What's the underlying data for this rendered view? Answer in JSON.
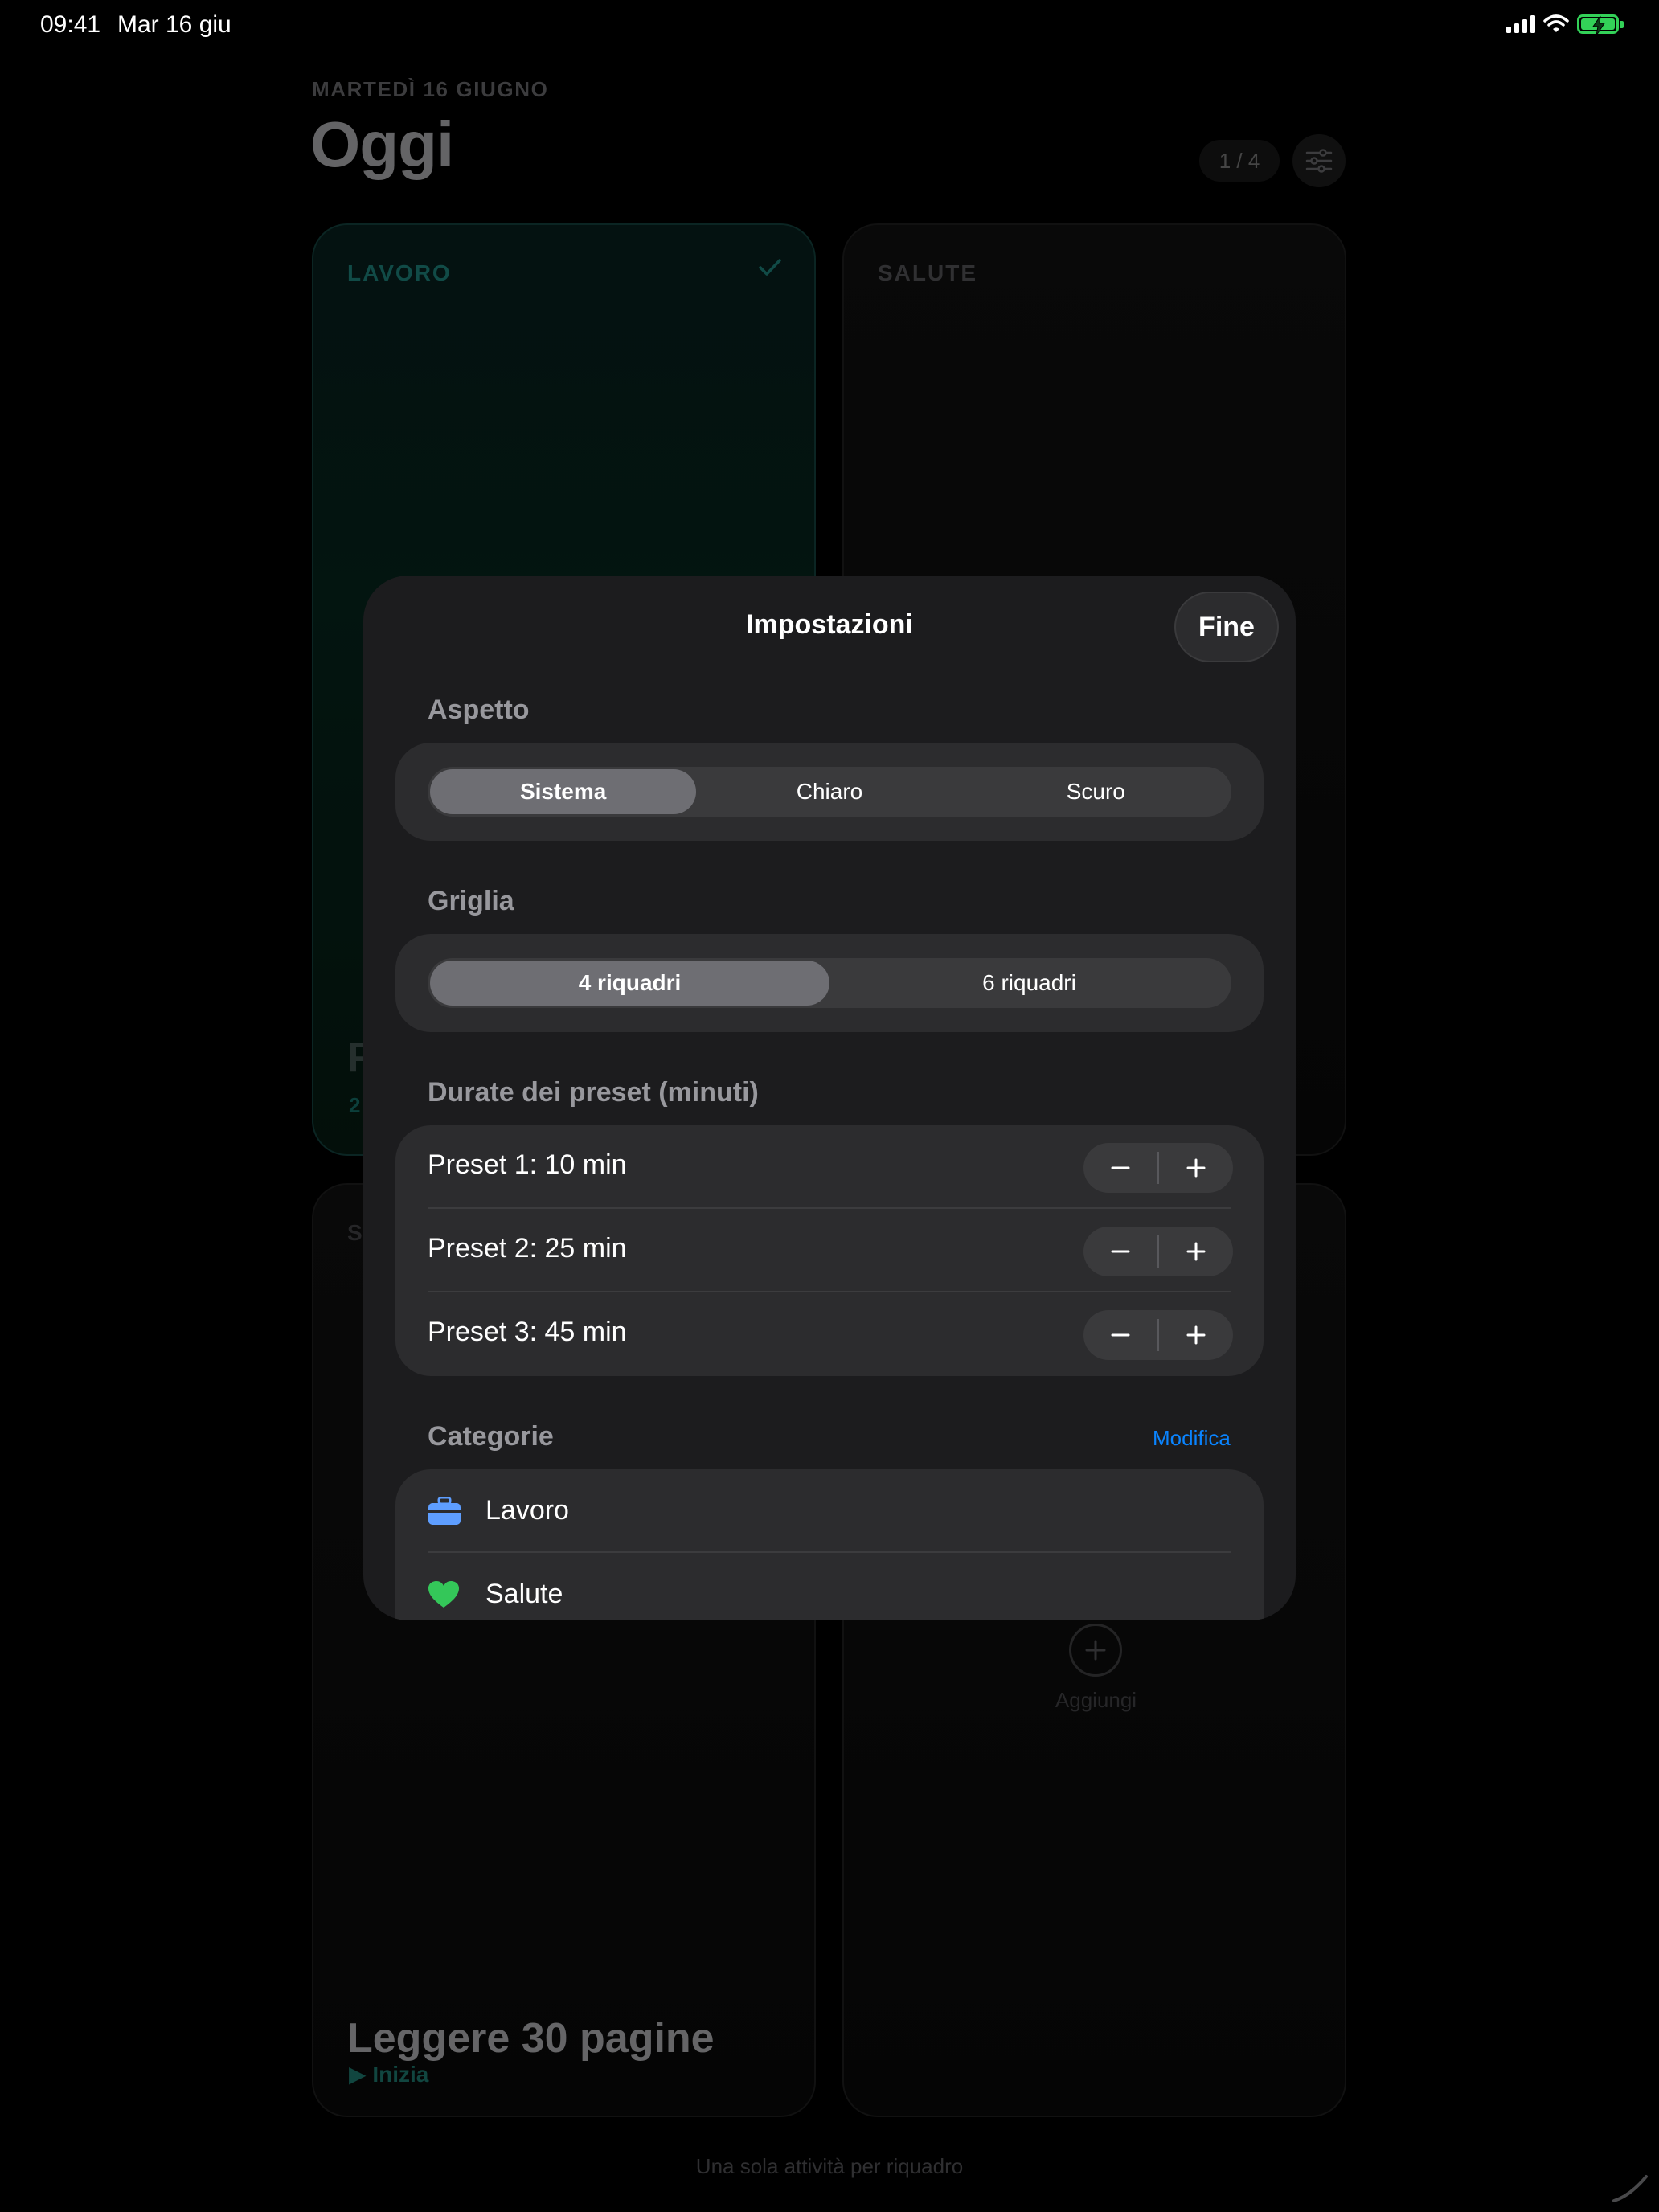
{
  "status_bar": {
    "time": "09:41",
    "date": "Mar 16 giu",
    "battery_color": "#33d158"
  },
  "background": {
    "date_label": "MARTEDÌ 16 GIUGNO",
    "title": "Oggi",
    "page_counter": "1 / 4",
    "filter_icon": "sliders-icon",
    "cards": {
      "lavoro": {
        "label": "LAVORO",
        "task_title_visible": "F",
        "sub_visible": "2"
      },
      "salute": {
        "label": "SALUTE"
      },
      "bottom_left": {
        "label_visible": "S",
        "task_title": "Leggere 30 pagine",
        "start_label": "▶ Inizia"
      },
      "bottom_right": {
        "add_label": "Aggiungi"
      }
    },
    "footer_note": "Una sola attività per riquadro"
  },
  "modal": {
    "title": "Impostazioni",
    "done_label": "Fine",
    "appearance": {
      "header": "Aspetto",
      "options": [
        "Sistema",
        "Chiaro",
        "Scuro"
      ],
      "selected": "Sistema"
    },
    "grid": {
      "header": "Griglia",
      "options": [
        "4 riquadri",
        "6 riquadri"
      ],
      "selected": "4 riquadri"
    },
    "presets": {
      "header": "Durate dei preset (minuti)",
      "items": [
        {
          "label": "Preset 1: 10 min",
          "minutes": 10
        },
        {
          "label": "Preset 2: 25 min",
          "minutes": 25
        },
        {
          "label": "Preset 3: 45 min",
          "minutes": 45
        }
      ]
    },
    "categories": {
      "header": "Categorie",
      "edit_label": "Modifica",
      "items": [
        {
          "label": "Lavoro",
          "icon": "briefcase-icon",
          "color": "#5e9eff"
        },
        {
          "label": "Salute",
          "icon": "heart-icon",
          "color": "#34c759"
        }
      ]
    }
  },
  "colors": {
    "accent_teal": "#155c57",
    "link_blue": "#0a84ff",
    "modal_bg": "#1c1c1e",
    "section_bg": "#2c2c2e"
  }
}
